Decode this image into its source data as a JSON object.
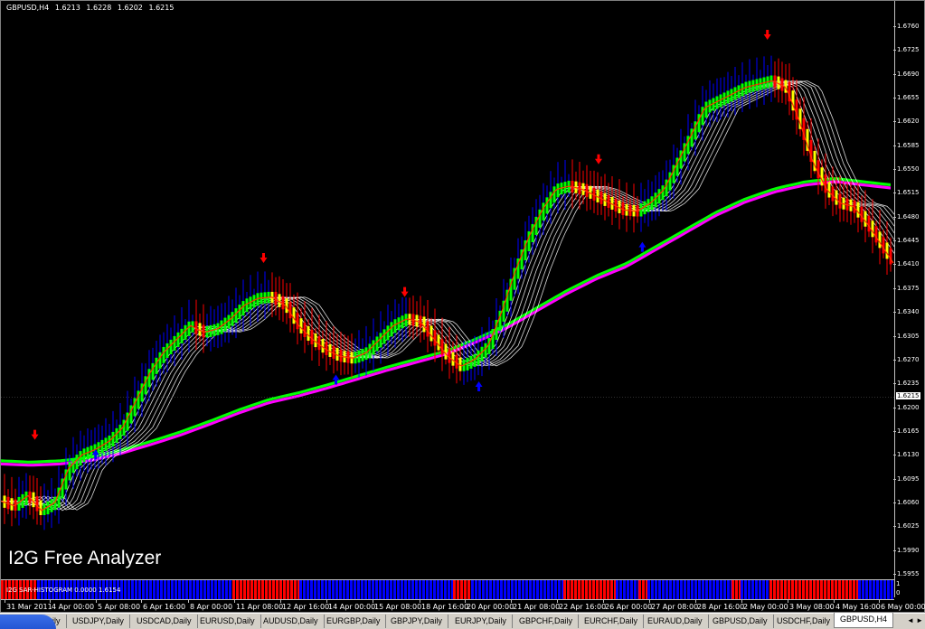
{
  "header": {
    "symbol": "GBPUSD,H4",
    "open": "1.6213",
    "high": "1.6228",
    "low": "1.6202",
    "close": "1.6215"
  },
  "watermark": "I2G Free Analyzer",
  "current_price": "1.6215",
  "price_ticks": [
    "1.6760",
    "1.6725",
    "1.6690",
    "1.6655",
    "1.6620",
    "1.6585",
    "1.6550",
    "1.6515",
    "1.6480",
    "1.6445",
    "1.6410",
    "1.6375",
    "1.6340",
    "1.6305",
    "1.6270",
    "1.6235",
    "1.6200",
    "1.6165",
    "1.6130",
    "1.6095",
    "1.6060",
    "1.6025",
    "1.5990",
    "1.5955"
  ],
  "indicator": {
    "label": "I2G SAR-HISTOGRAM 0.0000 1.6154",
    "scale_top": "1",
    "scale_bottom": "0"
  },
  "time_labels": [
    "31 Mar 2011",
    "4 Apr 00:00",
    "5 Apr 08:00",
    "6 Apr 16:00",
    "8 Apr 00:00",
    "11 Apr 08:00",
    "12 Apr 16:00",
    "14 Apr 00:00",
    "15 Apr 08:00",
    "18 Apr 16:00",
    "20 Apr 00:00",
    "21 Apr 08:00",
    "22 Apr 16:00",
    "26 Apr 00:00",
    "27 Apr 08:00",
    "28 Apr 16:00",
    "2 May 00:00",
    "3 May 08:00",
    "4 May 16:00",
    "6 May 00:00"
  ],
  "tabs": [
    "GBPUSD,Daily",
    "USDJPY,Daily",
    "USDCAD,Daily",
    "EURUSD,Daily",
    "AUDUSD,Daily",
    "EURGBP,Daily",
    "GBPJPY,Daily",
    "EURJPY,Daily",
    "GBPCHF,Daily",
    "EURCHF,Daily",
    "EURAUD,Daily",
    "GBPUSD,Daily",
    "USDCHF,Daily",
    "GBPUSD,H4"
  ],
  "active_tab": "GBPUSD,H4",
  "colors": {
    "background": "#000000",
    "bull": "#00ff00",
    "bear": "#ff0000",
    "wick_up": "#0000ff",
    "wick_down": "#ff0000",
    "ribbon_fast": "#ffffff",
    "ribbon_slow_a": "#00ff00",
    "ribbon_slow_b": "#ff00ff",
    "body_down_alt": "#ffff00",
    "hist_up": "#0000ff",
    "hist_down": "#ff0000"
  },
  "chart_data": {
    "type": "line",
    "title": "",
    "price_range": [
      1.5955,
      1.676
    ],
    "close_path": [
      1.6062,
      1.6055,
      1.607,
      1.6048,
      1.606,
      1.611,
      1.613,
      1.6138,
      1.615,
      1.617,
      1.621,
      1.625,
      1.628,
      1.63,
      1.632,
      1.631,
      1.6315,
      1.633,
      1.635,
      1.636,
      1.6362,
      1.635,
      1.632,
      1.63,
      1.6285,
      1.6275,
      1.6272,
      1.628,
      1.63,
      1.632,
      1.633,
      1.6325,
      1.63,
      1.6275,
      1.626,
      1.627,
      1.629,
      1.634,
      1.64,
      1.645,
      1.649,
      1.652,
      1.6525,
      1.652,
      1.651,
      1.65,
      1.649,
      1.6488,
      1.65,
      1.652,
      1.656,
      1.66,
      1.664,
      1.665,
      1.666,
      1.667,
      1.6675,
      1.668,
      1.667,
      1.662,
      1.656,
      1.652,
      1.65,
      1.6495,
      1.647,
      1.644,
      1.641
    ],
    "slow_ma": [
      1.612,
      1.6118,
      1.612,
      1.6125,
      1.6135,
      1.6148,
      1.6162,
      1.6178,
      1.6195,
      1.621,
      1.622,
      1.6232,
      1.6245,
      1.6258,
      1.627,
      1.6282,
      1.63,
      1.632,
      1.6345,
      1.637,
      1.6392,
      1.641,
      1.6435,
      1.646,
      1.6485,
      1.6505,
      1.652,
      1.653,
      1.6535,
      1.653,
      1.6525
    ],
    "arrows_down": [
      [
        0.038,
        1.616
      ],
      [
        0.294,
        1.642
      ],
      [
        0.452,
        1.637
      ],
      [
        0.669,
        1.6565
      ],
      [
        0.858,
        1.6748
      ]
    ],
    "arrows_up": [
      [
        0.106,
        1.613
      ],
      [
        0.375,
        1.624
      ],
      [
        0.535,
        1.623
      ],
      [
        0.718,
        1.6435
      ]
    ]
  }
}
